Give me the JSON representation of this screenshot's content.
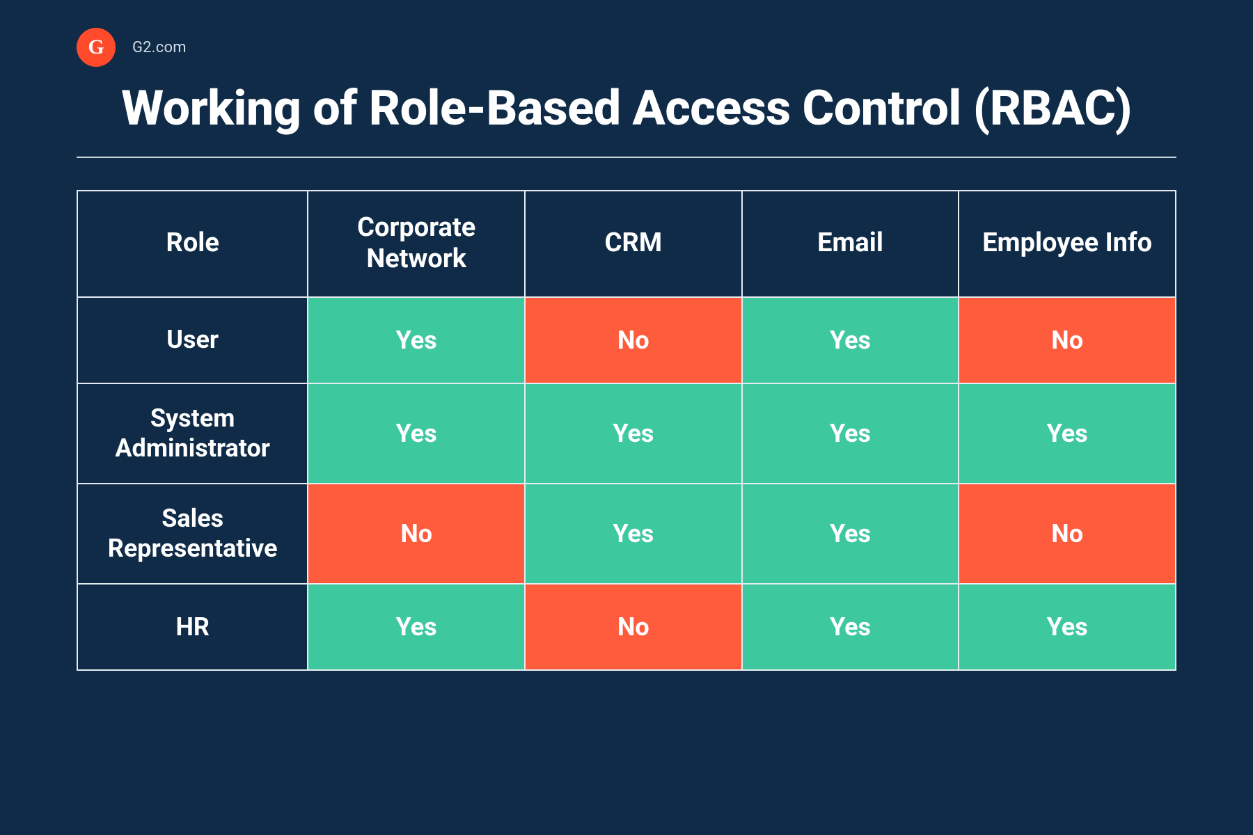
{
  "brand": {
    "site_label": "G2.com",
    "logo_letter": "G"
  },
  "title": "Working of Role-Based Access Control (RBAC)",
  "colors": {
    "background": "#0f2b47",
    "yes_cell": "#3ec89e",
    "no_cell": "#ff5c3e",
    "logo_bg": "#ff4a2b",
    "border": "#e6ecf1"
  },
  "table": {
    "columns": [
      "Role",
      "Corporate Network",
      "CRM",
      "Email",
      "Employee Info"
    ],
    "rows": [
      {
        "role": "User",
        "values": [
          "Yes",
          "No",
          "Yes",
          "No"
        ]
      },
      {
        "role": "System Administrator",
        "values": [
          "Yes",
          "Yes",
          "Yes",
          "Yes"
        ]
      },
      {
        "role": "Sales Representative",
        "values": [
          "No",
          "Yes",
          "Yes",
          "No"
        ]
      },
      {
        "role": "HR",
        "values": [
          "Yes",
          "No",
          "Yes",
          "Yes"
        ]
      }
    ],
    "labels": {
      "yes": "Yes",
      "no": "No"
    }
  },
  "chart_data": {
    "type": "table",
    "title": "Working of Role-Based Access Control (RBAC)",
    "columns": [
      "Role",
      "Corporate Network",
      "CRM",
      "Email",
      "Employee Info"
    ],
    "rows": [
      [
        "User",
        "Yes",
        "No",
        "Yes",
        "No"
      ],
      [
        "System Administrator",
        "Yes",
        "Yes",
        "Yes",
        "Yes"
      ],
      [
        "Sales Representative",
        "No",
        "Yes",
        "Yes",
        "No"
      ],
      [
        "HR",
        "Yes",
        "No",
        "Yes",
        "Yes"
      ]
    ]
  }
}
